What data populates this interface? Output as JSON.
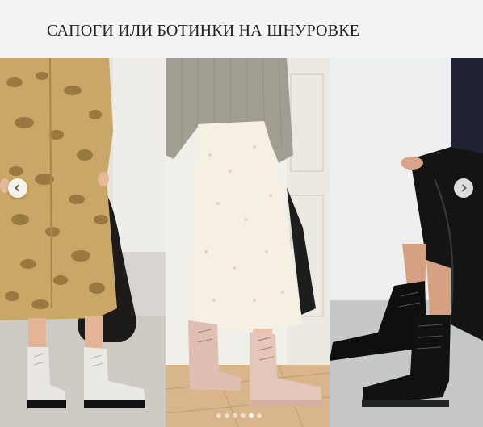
{
  "header": {
    "title": "САПОГИ ИЛИ БОТИНКИ НА ШНУРОВКЕ"
  },
  "carousel": {
    "prev_icon": "chevron-left-icon",
    "next_icon": "chevron-right-icon",
    "slide_count": 6,
    "active_slide": 5,
    "slides": [
      {
        "description_icon": "snake-print-coat-white-combat-boots-photo"
      },
      {
        "description_icon": "floral-skirt-pink-lace-up-boots-photo"
      },
      {
        "description_icon": "black-skirt-black-combat-boots-photo"
      }
    ]
  },
  "colors": {
    "header_bg": "#f3f3f3",
    "title_text": "#222222",
    "dot_active": "#ffffff"
  }
}
